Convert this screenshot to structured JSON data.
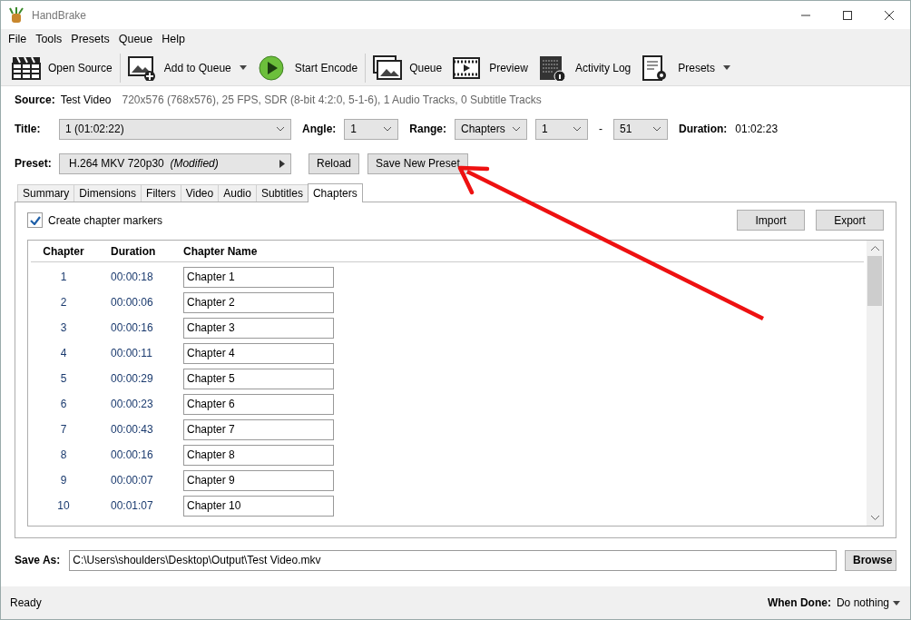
{
  "window": {
    "title": "HandBrake"
  },
  "menu": [
    "File",
    "Tools",
    "Presets",
    "Queue",
    "Help"
  ],
  "toolbar": [
    {
      "label": "Open Source",
      "dropdown": false
    },
    {
      "label": "Add to Queue",
      "dropdown": true
    },
    {
      "label": "Start Encode",
      "dropdown": false
    },
    {
      "label": "Queue",
      "dropdown": false
    },
    {
      "label": "Preview",
      "dropdown": false
    },
    {
      "label": "Activity Log",
      "dropdown": false
    },
    {
      "label": "Presets",
      "dropdown": true
    }
  ],
  "source": {
    "label": "Source:",
    "name": "Test Video",
    "info": "720x576 (768x576), 25 FPS, SDR (8-bit 4:2:0, 5-1-6), 1 Audio Tracks, 0 Subtitle Tracks"
  },
  "title_row": {
    "title_label": "Title:",
    "title_value": "1  (01:02:22)",
    "angle_label": "Angle:",
    "angle_value": "1",
    "range_label": "Range:",
    "range_mode": "Chapters",
    "range_start": "1",
    "range_sep": "-",
    "range_end": "51",
    "duration_label": "Duration:",
    "duration_value": "01:02:23"
  },
  "preset": {
    "label": "Preset:",
    "value": "H.264 MKV 720p30",
    "modifier": "(Modified)",
    "buttons": [
      "Reload",
      "Save New Preset"
    ]
  },
  "tabs": [
    {
      "label": "Summary",
      "selected": false
    },
    {
      "label": "Dimensions",
      "selected": false
    },
    {
      "label": "Filters",
      "selected": false
    },
    {
      "label": "Video",
      "selected": false
    },
    {
      "label": "Audio",
      "selected": false
    },
    {
      "label": "Subtitles",
      "selected": false
    },
    {
      "label": "Chapters",
      "selected": true
    }
  ],
  "chapters_panel": {
    "create_markers": {
      "label": "Create chapter markers",
      "checked": true
    },
    "buttons": [
      "Import",
      "Export"
    ],
    "table": {
      "columns": [
        "Chapter",
        "Duration",
        "Chapter Name"
      ],
      "rows": [
        {
          "chapter": "1",
          "duration": "00:00:18",
          "name": "Chapter 1"
        },
        {
          "chapter": "2",
          "duration": "00:00:06",
          "name": "Chapter 2"
        },
        {
          "chapter": "3",
          "duration": "00:00:16",
          "name": "Chapter 3"
        },
        {
          "chapter": "4",
          "duration": "00:00:11",
          "name": "Chapter 4"
        },
        {
          "chapter": "5",
          "duration": "00:00:29",
          "name": "Chapter 5"
        },
        {
          "chapter": "6",
          "duration": "00:00:23",
          "name": "Chapter 6"
        },
        {
          "chapter": "7",
          "duration": "00:00:43",
          "name": "Chapter 7"
        },
        {
          "chapter": "8",
          "duration": "00:00:16",
          "name": "Chapter 8"
        },
        {
          "chapter": "9",
          "duration": "00:00:07",
          "name": "Chapter 9"
        },
        {
          "chapter": "10",
          "duration": "00:01:07",
          "name": "Chapter 10"
        }
      ]
    }
  },
  "save_as": {
    "label": "Save As:",
    "value": "C:\\Users\\shoulders\\Desktop\\Output\\Test Video.mkv",
    "button": "Browse"
  },
  "status_bar": {
    "status": "Ready",
    "when_done_label": "When Done:",
    "when_done_value": "Do nothing"
  }
}
